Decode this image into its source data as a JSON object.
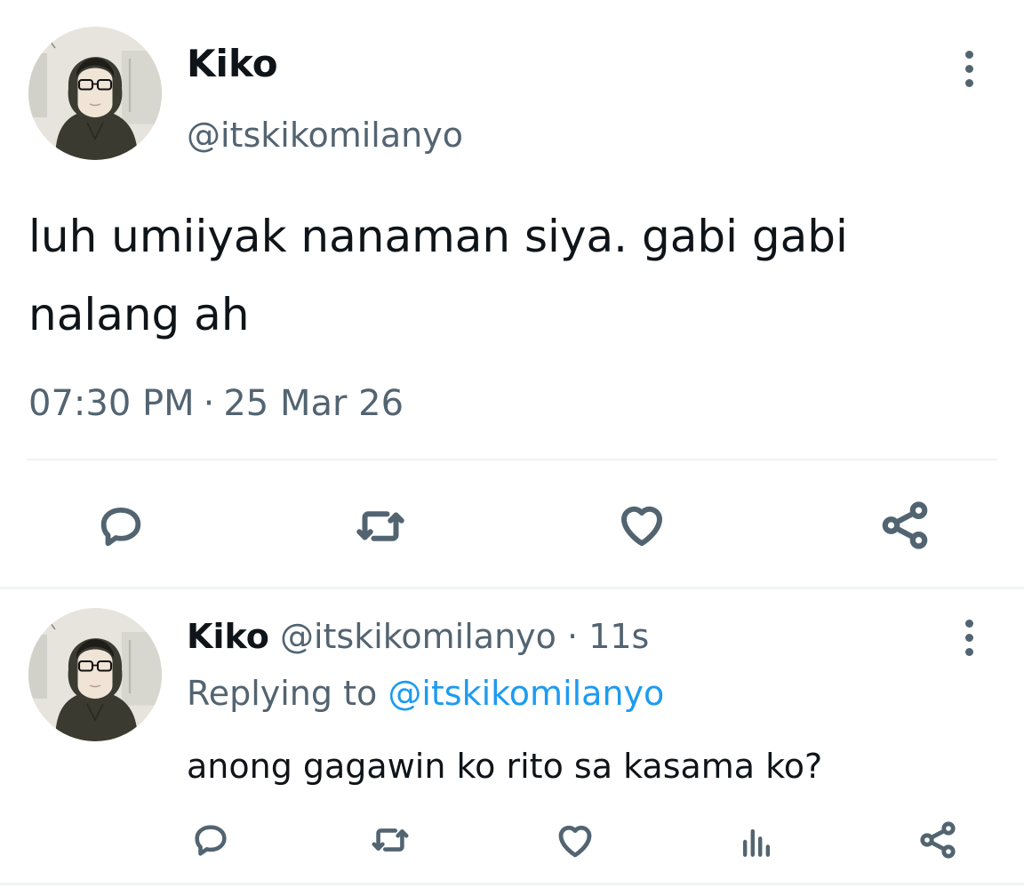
{
  "main_tweet": {
    "author_name": "Kiko",
    "author_handle": "@itskikomilanyo",
    "text": "luh umiiyak nanaman siya. gabi gabi nalang ah",
    "time": "07:30 PM",
    "separator": "·",
    "date": "25 Mar 26",
    "actions": {
      "reply_icon": "comment-bubble-icon",
      "retweet_icon": "retweet-icon",
      "like_icon": "heart-icon",
      "share_icon": "share-nodes-icon"
    }
  },
  "reply_tweet": {
    "author_name": "Kiko",
    "author_handle": "@itskikomilanyo",
    "separator": "·",
    "relative_time": "11s",
    "replying_to_label": "Replying to",
    "replying_to_handle": "@itskikomilanyo",
    "text": "anong gagawin ko rito sa kasama ko?",
    "actions": {
      "reply_icon": "comment-bubble-icon",
      "retweet_icon": "retweet-icon",
      "like_icon": "heart-icon",
      "views_icon": "views-bar-chart-icon",
      "share_icon": "share-nodes-icon"
    }
  },
  "colors": {
    "primary_text": "#0f1419",
    "secondary_text": "#536471",
    "link": "#1d9bf0",
    "divider": "#eff3f4",
    "background": "#ffffff"
  }
}
